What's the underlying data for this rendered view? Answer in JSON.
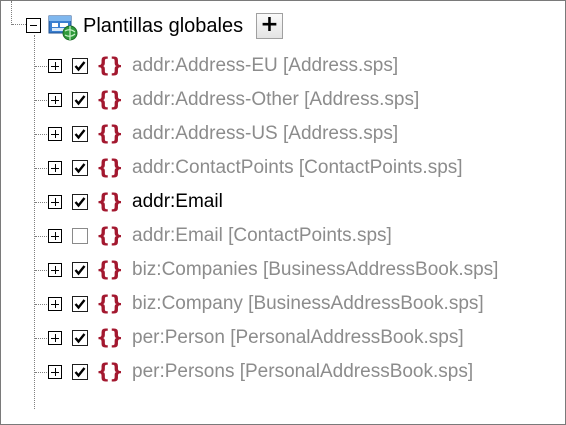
{
  "root": {
    "label": "Plantillas globales",
    "add_label": "+"
  },
  "icons": {
    "root": "global-templates-icon",
    "expand": "plus-expander-icon",
    "collapse": "minus-expander-icon",
    "template": "curly-braces-icon"
  },
  "colors": {
    "braces": "#a3182f",
    "inactive_text": "#8c8c8c",
    "active_text": "#000000"
  },
  "items": [
    {
      "label": "addr:Address-EU [Address.sps]",
      "checked": true,
      "active": false
    },
    {
      "label": "addr:Address-Other [Address.sps]",
      "checked": true,
      "active": false
    },
    {
      "label": "addr:Address-US [Address.sps]",
      "checked": true,
      "active": false
    },
    {
      "label": "addr:ContactPoints [ContactPoints.sps]",
      "checked": true,
      "active": false
    },
    {
      "label": "addr:Email",
      "checked": true,
      "active": true
    },
    {
      "label": "addr:Email [ContactPoints.sps]",
      "checked": false,
      "active": false
    },
    {
      "label": "biz:Companies [BusinessAddressBook.sps]",
      "checked": true,
      "active": false
    },
    {
      "label": "biz:Company [BusinessAddressBook.sps]",
      "checked": true,
      "active": false
    },
    {
      "label": "per:Person [PersonalAddressBook.sps]",
      "checked": true,
      "active": false
    },
    {
      "label": "per:Persons [PersonalAddressBook.sps]",
      "checked": true,
      "active": false
    }
  ]
}
